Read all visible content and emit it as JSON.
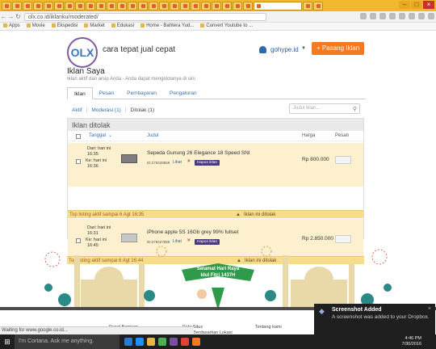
{
  "browser": {
    "url": "olx.co.id/iklanku/moderated/",
    "bookmarks": [
      "Apps",
      "Movie",
      "Ekspedisi",
      "Market",
      "Edukasi",
      "Home - Bahtera Yud...",
      "Convert Youtube to ..."
    ]
  },
  "header": {
    "logo": "OLX",
    "tagline": "cara tepat jual cepat",
    "username": "gohype.id",
    "post_button": "+ Pasang Iklan"
  },
  "page": {
    "title": "Iklan Saya",
    "subtitle": "Iklan aktif dan arsip Anda - Anda dapat mengelolanya di sini"
  },
  "tabs": [
    "Iklan",
    "Pesan",
    "Pembayaran",
    "Pengaturan"
  ],
  "subtabs": {
    "aktif": "Aktif",
    "moderasi": "Moderasi (1)",
    "ditolak": "Ditolak (1)"
  },
  "search": {
    "placeholder": "Judul iklan..."
  },
  "panel": {
    "title": "Iklan ditolak",
    "columns": {
      "tanggal": "Tanggal",
      "judul": "Judul",
      "harga": "Harga",
      "pesan": "Pesan"
    }
  },
  "ads": [
    {
      "dari_label": "Dari: hari ini",
      "dari_time": "16:35",
      "ke_label": "Ke: hari ini",
      "ke_time": "16:36",
      "title": "Sepeda Gunung 26 Elegance 18 Speed SNI",
      "id": "ID:279228559",
      "lihat": "Lihat",
      "hapus": "Hapus iklan",
      "price": "Rp 800.000",
      "status_left": "Top listing aktif sampai 6 Agt 16:35",
      "status_right": "Iklan ini ditolak"
    },
    {
      "dari_label": "Dari: hari ini",
      "dari_time": "16:31",
      "ke_label": "Ke: hari ini",
      "ke_time": "16:45",
      "title": "iPhone apple 5S 16Gb grey 99% fullset",
      "id": "ID:279227889",
      "lihat": "Lihat",
      "hapus": "Hapus iklan",
      "price": "Rp 2.850.000",
      "status_left": "Top listing aktif sampai 6 Agt 16:44",
      "status_right": "Iklan ini ditolak"
    }
  ],
  "banner": {
    "line1": "Selamat Hari Raya",
    "line2": "Idul Fitri 1437H"
  },
  "footer": {
    "c1": "Pusat Bantuan",
    "c2": "Peta Situs",
    "c2b": "Iklan Berdasarkan Lokasi",
    "c3": "Tentang kami"
  },
  "loading": "Waiting for www.google.co.id...",
  "toast": {
    "title": "Screenshot Added",
    "body": "A screenshot was added to your Dropbox."
  },
  "taskbar": {
    "cortana": "I'm Cortana. Ask me anything.",
    "time": "4:46 PM",
    "date": "7/30/2016"
  }
}
